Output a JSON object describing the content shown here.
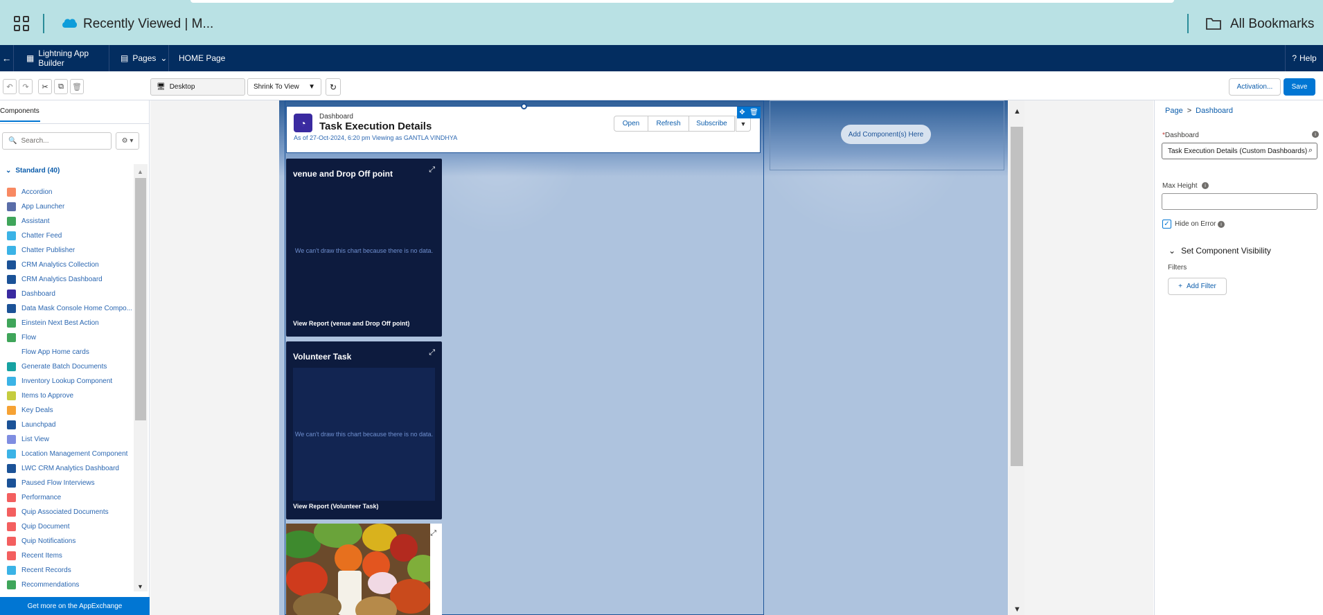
{
  "browser": {
    "tab_title": "Recently Viewed | M...",
    "bookmarks_label": "All Bookmarks"
  },
  "nav": {
    "back": "←",
    "app_builder": "Lightning App Builder",
    "pages": "Pages",
    "page_name": "HOME Page",
    "help": "Help"
  },
  "toolbar": {
    "device": "Desktop",
    "zoom": "Shrink To View",
    "activation": "Activation...",
    "save": "Save"
  },
  "left_panel": {
    "tab": "Components",
    "search_placeholder": "Search...",
    "section": "Standard (40)",
    "items": [
      {
        "label": "Accordion",
        "color": "#f88962"
      },
      {
        "label": "App Launcher",
        "color": "#5a6da8"
      },
      {
        "label": "Assistant",
        "color": "#3fa55a"
      },
      {
        "label": "Chatter Feed",
        "color": "#3bb3e6"
      },
      {
        "label": "Chatter Publisher",
        "color": "#3bb3e6"
      },
      {
        "label": "CRM Analytics Collection",
        "color": "#1b5297"
      },
      {
        "label": "CRM Analytics Dashboard",
        "color": "#1b5297"
      },
      {
        "label": "Dashboard",
        "color": "#3a2aa0"
      },
      {
        "label": "Data Mask Console Home Compo...",
        "color": "#1b5297"
      },
      {
        "label": "Einstein Next Best Action",
        "color": "#3fa55a"
      },
      {
        "label": "Flow",
        "color": "#3fa55a"
      },
      {
        "label": "Flow App Home cards",
        "color": ""
      },
      {
        "label": "Generate Batch Documents",
        "color": "#16a2a2"
      },
      {
        "label": "Inventory Lookup Component",
        "color": "#3bb3e6"
      },
      {
        "label": "Items to Approve",
        "color": "#c5cc3f"
      },
      {
        "label": "Key Deals",
        "color": "#f6a234"
      },
      {
        "label": "Launchpad",
        "color": "#1b5297"
      },
      {
        "label": "List View",
        "color": "#7f8de1"
      },
      {
        "label": "Location Management Component",
        "color": "#3bb3e6"
      },
      {
        "label": "LWC CRM Analytics Dashboard",
        "color": "#1b5297"
      },
      {
        "label": "Paused Flow Interviews",
        "color": "#1b5297"
      },
      {
        "label": "Performance",
        "color": "#f35f5f"
      },
      {
        "label": "Quip Associated Documents",
        "color": "#f35f5f"
      },
      {
        "label": "Quip Document",
        "color": "#f35f5f"
      },
      {
        "label": "Quip Notifications",
        "color": "#f35f5f"
      },
      {
        "label": "Recent Items",
        "color": "#f35f5f"
      },
      {
        "label": "Recent Records",
        "color": "#3bb3e6"
      },
      {
        "label": "Recommendations",
        "color": "#3fa55a"
      }
    ],
    "footer": "Get more on the AppExchange"
  },
  "dashboard": {
    "label": "Dashboard",
    "title": "Task Execution Details",
    "subtitle": "As of 27-Oct-2024, 6:20 pm Viewing as GANTLA VINDHYA",
    "buttons": [
      "Open",
      "Refresh",
      "Subscribe"
    ]
  },
  "cards": [
    {
      "title": "venue and Drop Off point",
      "nodata": "We can't draw this chart because there is no data.",
      "link": "View Report (venue and Drop Off point)"
    },
    {
      "title": "Volunteer Task",
      "nodata": "We can't draw this chart because there is no data.",
      "link": "View Report (Volunteer Task)"
    }
  ],
  "canvas": {
    "add_component": "Add Component(s) Here"
  },
  "props": {
    "crumb_page": "Page",
    "crumb_sep": ">",
    "crumb_current": "Dashboard",
    "dashboard_label": "Dashboard",
    "dashboard_value": "Task Execution Details (Custom Dashboards)",
    "max_height_label": "Max Height",
    "max_height_value": "",
    "hide_on_error": "Hide on Error",
    "hide_on_error_checked": true,
    "visibility_heading": "Set Component Visibility",
    "filters_label": "Filters",
    "add_filter": "Add Filter"
  }
}
